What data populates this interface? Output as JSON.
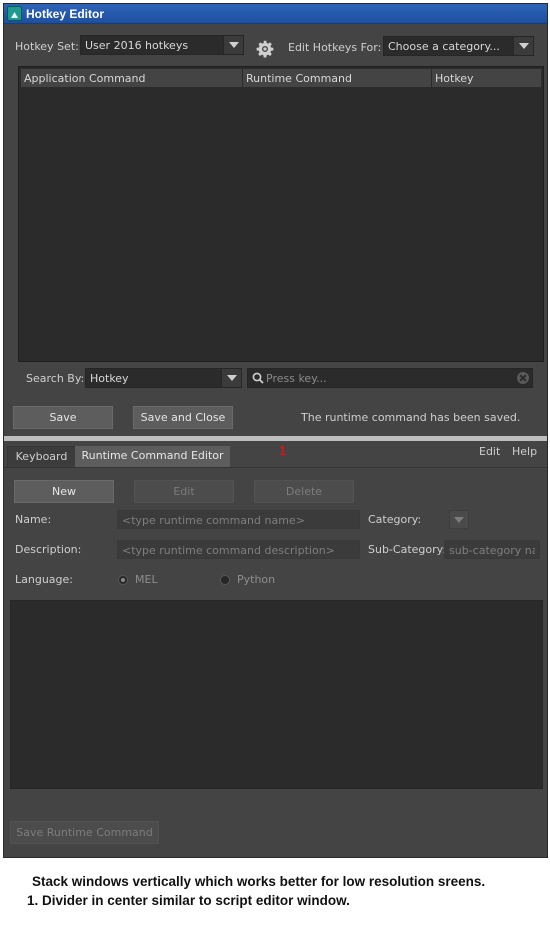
{
  "window": {
    "title": "Hotkey Editor"
  },
  "hotkey_set": {
    "label": "Hotkey Set:",
    "value": "User 2016 hotkeys"
  },
  "edit_for": {
    "label": "Edit Hotkeys For:",
    "value": "Choose a category..."
  },
  "table": {
    "columns": [
      "Application Command",
      "Runtime Command",
      "Hotkey"
    ]
  },
  "search": {
    "label": "Search By:",
    "type_value": "Hotkey",
    "placeholder": "Press key..."
  },
  "buttons": {
    "save": "Save",
    "save_close": "Save and Close"
  },
  "status": "The runtime command has been saved.",
  "tabs": [
    "Keyboard",
    "Runtime Command Editor"
  ],
  "menu": {
    "edit": "Edit",
    "help": "Help"
  },
  "rce": {
    "new": "New",
    "edit": "Edit",
    "delete": "Delete",
    "name_label": "Name:",
    "name_placeholder": "<type runtime command name>",
    "category_label": "Category:",
    "desc_label": "Description:",
    "desc_placeholder": "<type runtime command description>",
    "subcat_label": "Sub-Category:",
    "subcat_placeholder": "sub-category na",
    "language_label": "Language:",
    "lang_mel": "MEL",
    "lang_python": "Python",
    "save_runtime": "Save Runtime Command"
  },
  "annotation": {
    "marker": "1",
    "line1": "Stack windows vertically which works better for low resolution sreens.",
    "line2": "1. Divider in center similar to script editor window."
  }
}
